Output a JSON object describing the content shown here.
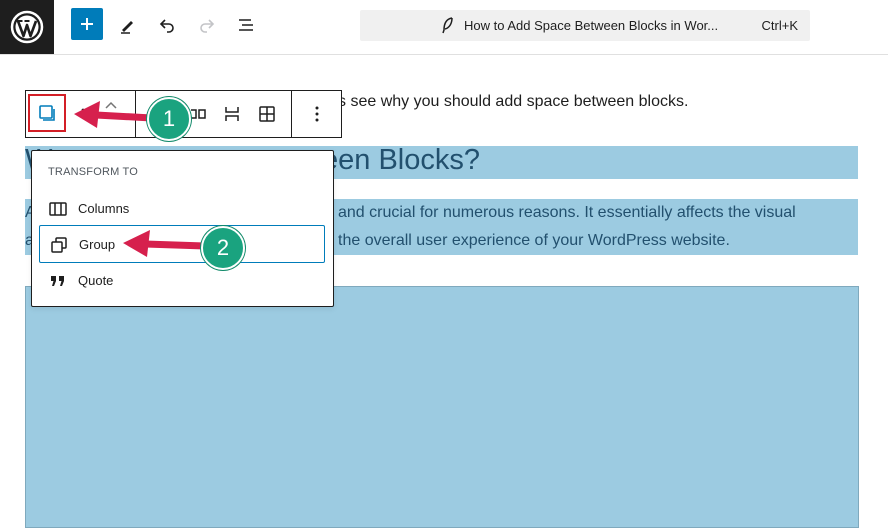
{
  "topbar": {
    "document_title": "How to Add Space Between Blocks in Wor...",
    "shortcut": "Ctrl+K"
  },
  "content": {
    "intro_fragment": "s see why you should add space between blocks.",
    "heading_fragment": "een Blocks?",
    "heading_stub": "W",
    "para_line1": "and crucial for numerous reasons. It essentially affects the visual",
    "para_line2": "the overall user experience of your WordPress website.",
    "para_stub1": "A",
    "para_stub2": "a"
  },
  "transform_menu": {
    "heading": "TRANSFORM TO",
    "items": [
      {
        "label": "Columns",
        "icon": "columns-icon"
      },
      {
        "label": "Group",
        "icon": "group-icon"
      },
      {
        "label": "Quote",
        "icon": "quote-icon"
      }
    ]
  },
  "annotations": {
    "step1": "1",
    "step2": "2",
    "arrow_color": "#d6204d",
    "badge_color": "#1aa37f"
  },
  "colors": {
    "highlight": "#9ccbe1",
    "accent": "#007cba",
    "selection_border": "#d31f26"
  }
}
